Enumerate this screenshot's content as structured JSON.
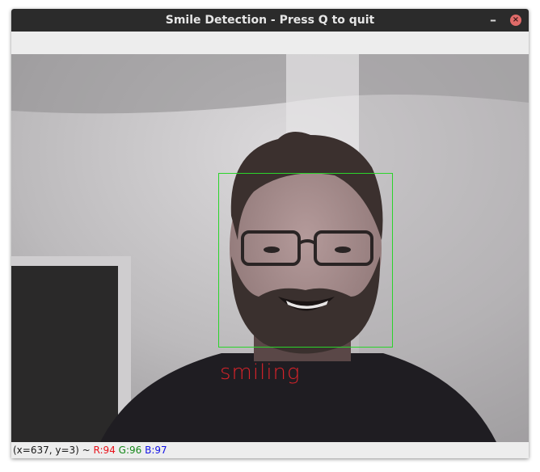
{
  "window": {
    "title": "Smile Detection - Press Q to quit",
    "minimize_glyph": "–",
    "close_glyph": "×"
  },
  "detection": {
    "label": "smiling",
    "box_color": "#2bd42b",
    "label_color": "#d8232a"
  },
  "statusbar": {
    "coords": "(x=637, y=3) ~",
    "r": "R:94",
    "g": "G:96",
    "b": "B:97",
    "r_color": "#e8111a",
    "g_color": "#16881a",
    "b_color": "#1212e6"
  }
}
